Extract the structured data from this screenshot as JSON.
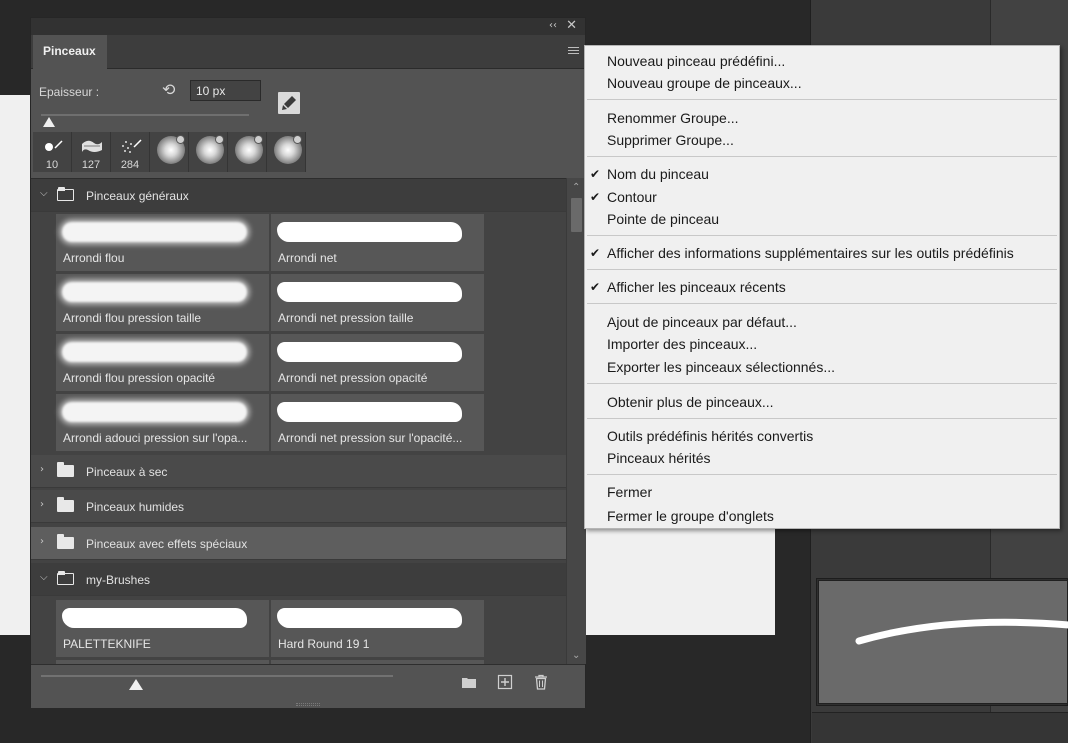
{
  "panel": {
    "tab_label": "Pinceaux",
    "collapse_glyph": "‹‹",
    "close_glyph": "✕",
    "size_label": "Epaisseur :",
    "size_value": "10 px",
    "reset_glyph": "⟲",
    "recent_brushes": [
      {
        "kind": "hard",
        "size": "10"
      },
      {
        "kind": "splash",
        "size": "127"
      },
      {
        "kind": "spray",
        "size": "284"
      },
      {
        "kind": "soft",
        "size": ""
      },
      {
        "kind": "soft",
        "size": ""
      },
      {
        "kind": "soft",
        "size": ""
      },
      {
        "kind": "soft",
        "size": ""
      }
    ]
  },
  "groups": {
    "general": {
      "name": "Pinceaux généraux",
      "brushes": [
        "Arrondi flou",
        "Arrondi net",
        "Arrondi flou pression taille",
        "Arrondi net pression taille",
        "Arrondi flou pression opacité",
        "Arrondi net pression opacité",
        "Arrondi adouci pression sur l'opa...",
        "Arrondi net pression sur l'opacité..."
      ]
    },
    "dry": {
      "name": "Pinceaux à sec"
    },
    "wet": {
      "name": "Pinceaux humides"
    },
    "special": {
      "name": "Pinceaux avec effets spéciaux"
    },
    "mine": {
      "name": "my-Brushes",
      "brushes": [
        "PALETTEKNIFE",
        "Hard Round 19 1"
      ]
    }
  },
  "chevrons": {
    "open": "⌵",
    "closed": "›"
  },
  "scroll": {
    "up": "⌃",
    "down": "⌄"
  },
  "menu": {
    "check_glyph": "✔",
    "items": {
      "new_preset": "Nouveau pinceau prédéfini...",
      "new_group": "Nouveau groupe de pinceaux...",
      "rename_group": "Renommer Groupe...",
      "delete_group": "Supprimer Groupe...",
      "brush_name": "Nom du pinceau",
      "stroke": "Contour",
      "brush_tip": "Pointe de pinceau",
      "show_info": "Afficher des informations supplémentaires sur les outils prédéfinis",
      "show_recent": "Afficher les pinceaux récents",
      "restore_default": "Ajout de pinceaux par défaut...",
      "import": "Importer des pinceaux...",
      "export": "Exporter les pinceaux sélectionnés...",
      "get_more": "Obtenir plus de pinceaux...",
      "converted_legacy": "Outils prédéfinis hérités convertis",
      "legacy": "Pinceaux hérités",
      "close": "Fermer",
      "close_tab_group": "Fermer le groupe d'onglets"
    }
  }
}
